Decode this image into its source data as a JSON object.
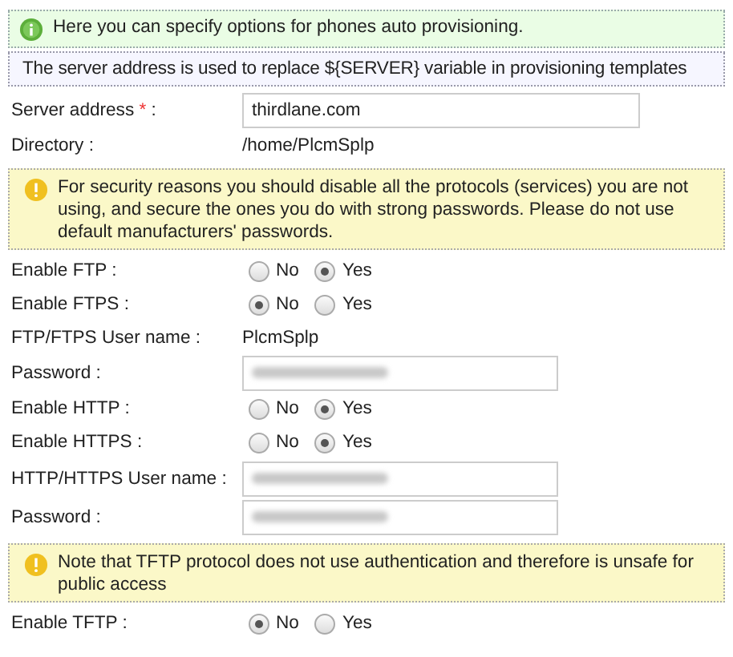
{
  "rows": [
    {
      "kind": "info",
      "text": "Here you can specify options for phones auto provisioning."
    },
    {
      "kind": "note",
      "text": "The server address is used to replace ${SERVER} variable in provisioning templates"
    },
    {
      "kind": "input",
      "label": "Server address",
      "mark": "*",
      "suffix": ":",
      "value": "thirdlane.com"
    },
    {
      "kind": "static",
      "label": "Directory  :",
      "value": "/home/PlcmSplp"
    },
    {
      "kind": "warning",
      "text": "For security reasons you should disable all the protocols (services) you are not using, and secure the ones you do with strong passwords. Please do not use default manufacturers' passwords."
    },
    {
      "kind": "radio",
      "label": "Enable FTP :",
      "options": [
        {
          "label": "No",
          "selected": false
        },
        {
          "label": "Yes",
          "selected": true
        }
      ]
    },
    {
      "kind": "radio",
      "label": "Enable FTPS :",
      "options": [
        {
          "label": "No",
          "selected": true
        },
        {
          "label": "Yes",
          "selected": false
        }
      ]
    },
    {
      "kind": "static",
      "label": "FTP/FTPS User name  :",
      "value": "PlcmSplp"
    },
    {
      "kind": "secret",
      "label": "Password :"
    },
    {
      "kind": "radio",
      "label": "Enable HTTP :",
      "options": [
        {
          "label": "No",
          "selected": false
        },
        {
          "label": "Yes",
          "selected": true
        }
      ]
    },
    {
      "kind": "radio",
      "label": "Enable HTTPS :",
      "options": [
        {
          "label": "No",
          "selected": false
        },
        {
          "label": "Yes",
          "selected": true
        }
      ]
    },
    {
      "kind": "secret",
      "label": "HTTP/HTTPS User name  :"
    },
    {
      "kind": "secret",
      "label": "Password :"
    },
    {
      "kind": "warning",
      "text": "Note that TFTP protocol does not use authentication and therefore is unsafe for public access"
    },
    {
      "kind": "radio",
      "label": "Enable TFTP :",
      "options": [
        {
          "label": "No",
          "selected": true
        },
        {
          "label": "Yes",
          "selected": false
        }
      ]
    }
  ]
}
